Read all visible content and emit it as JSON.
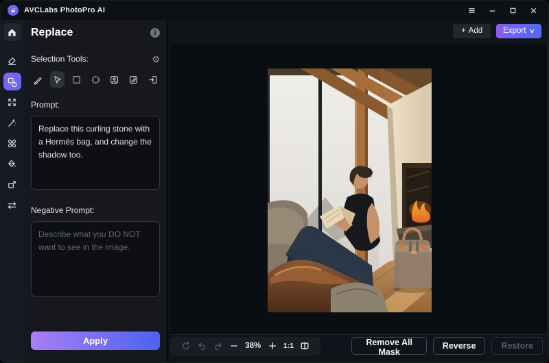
{
  "titlebar": {
    "app_title": "AVCLabs PhotoPro AI"
  },
  "panel": {
    "title": "Replace",
    "info_icon": "i",
    "selection_tools_label": "Selection Tools:",
    "gear_icon": "⚙",
    "prompt_label": "Prompt:",
    "prompt_value": "Replace this curling stone with a Hermès bag, and change the shadow too.",
    "negative_prompt_label": "Negative Prompt:",
    "negative_prompt_placeholder": "Describe what you DO NOT want to see in the image.",
    "apply_label": "Apply"
  },
  "rail_icons": [
    "home-icon",
    "eraser-icon",
    "replace-tool-icon",
    "upscale-icon",
    "magic-wand-icon",
    "colorize-icon",
    "paint-bucket-icon",
    "resize-icon",
    "adjust-sliders-icon"
  ],
  "selection_tool_icons": [
    "brush-tool-icon",
    "cursor-tool-icon",
    "rect-select-icon",
    "ellipse-select-icon",
    "subject-select-icon",
    "background-select-icon",
    "import-select-icon"
  ],
  "header": {
    "add_plus": "+",
    "add_label": "Add",
    "export_label": "Export",
    "export_chevron": "∨"
  },
  "toolbar": {
    "icons": [
      "reset-icon",
      "undo-icon",
      "redo-icon",
      "zoom-out-icon",
      "zoom-in-icon",
      "compare-icon"
    ],
    "zoom_value": "38%",
    "ratio_label": "1:1",
    "remove_all_mask_label": "Remove All Mask",
    "reverse_label": "Reverse",
    "restore_label": "Restore"
  },
  "colors": {
    "accent_gradient_start": "#8a5cf0",
    "accent_gradient_end": "#4e6bf5",
    "apply_gradient_start": "#a97ef5",
    "apply_gradient_end": "#4b63f2",
    "panel_bg": "#16181d",
    "rail_bg": "#151a23",
    "canvas_bg": "#0a0d12"
  }
}
